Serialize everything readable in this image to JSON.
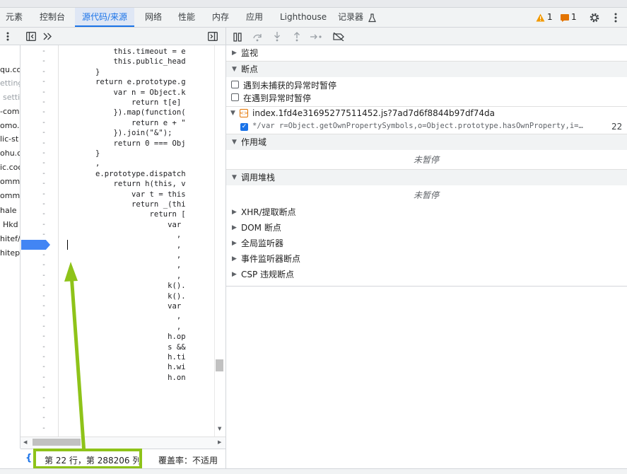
{
  "tabs": [
    "元素",
    "控制台",
    "源代码/来源",
    "网络",
    "性能",
    "内存",
    "应用",
    "Lighthouse",
    "记录器"
  ],
  "active_tab": "源代码/来源",
  "header_right": {
    "warnings": "1",
    "issues": "1"
  },
  "icons": {
    "flask": "flask-icon",
    "warning": "warning-triangle-icon",
    "issue": "issue-flag-icon",
    "settings": "gear-icon",
    "more": "kebab-menu-icon"
  },
  "navigator_items": [
    "qu.co",
    "etting",
    "setti",
    "-com",
    "omo.",
    "lic-st",
    "ohu.c",
    "ic.coo",
    "ommu",
    "ommu",
    "hale",
    "Hkd",
    "hitef/",
    "hitep"
  ],
  "line_numbers_dash": "-",
  "code_lines": [
    "            this.timeout = e",
    "            this.public_head",
    "        }",
    "        return e.prototype.g",
    "            var n = Object.k",
    "                return t[e]",
    "            }).map(function(",
    "                return e + \"",
    "            }).join(\"&\");",
    "            return 0 === Obj",
    "        }",
    "        ,",
    "        e.prototype.dispatch",
    "            return h(this, v",
    "                var t = this",
    "                return _(thi",
    "                    return [",
    "                        var",
    "                          ,",
    "                          ,",
    "                          ,",
    "                          ,",
    "                          ,",
    "                        k().",
    "                        k().",
    "                        var",
    "                          ,",
    "                          ,",
    "                        h.op",
    "                        s &&",
    "                        h.ti",
    "                        h.wi",
    "                        h.on"
  ],
  "status": {
    "position": "第 22 行，第 288206 列",
    "coverage": "覆盖率：不适用"
  },
  "right": {
    "watch": "监视",
    "breakpoints": "断点",
    "pause_uncaught": "遇到未捕获的异常时暂停",
    "pause_caught": "在遇到异常时暂停",
    "bp_file": "index.1fd4e31695277511452.js?7ad7d6f8844b97df74da",
    "bp_code": "*/var r=Object.getOwnPropertySymbols,o=Object.prototype.hasOwnProperty,i=…",
    "bp_line": "22",
    "scope": "作用域",
    "not_paused": "未暂停",
    "callstack": "调用堆栈",
    "not_paused2": "未暂停",
    "xhr": "XHR/提取断点",
    "dom": "DOM 断点",
    "global": "全局监听器",
    "event": "事件监听器断点",
    "csp": "CSP 违规断点"
  },
  "colors": {
    "accent": "#1a73e8",
    "highlight": "#8ec319",
    "breakpoint": "#4285f4"
  }
}
